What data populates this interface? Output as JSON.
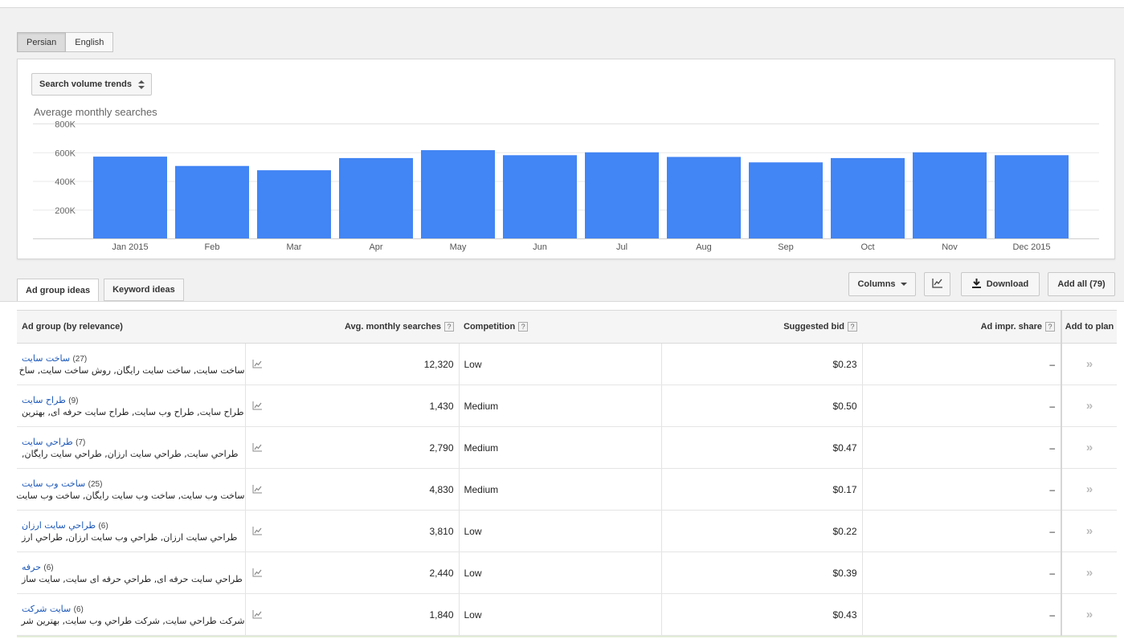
{
  "language_toggle": {
    "options": [
      "Persian",
      "English"
    ],
    "selected": "Persian"
  },
  "chart_panel": {
    "select_label": "Search volume trends"
  },
  "chart_data": {
    "type": "bar",
    "title": "Average monthly searches",
    "categories": [
      "Jan 2015",
      "Feb",
      "Mar",
      "Apr",
      "May",
      "Jun",
      "Jul",
      "Aug",
      "Sep",
      "Oct",
      "Nov",
      "Dec 2015"
    ],
    "values": [
      570000,
      505000,
      475000,
      560000,
      615000,
      580000,
      600000,
      568000,
      530000,
      560000,
      600000,
      580000
    ],
    "y_ticks": [
      "200K",
      "400K",
      "600K",
      "800K"
    ],
    "y_tick_values": [
      200000,
      400000,
      600000,
      800000
    ],
    "ylim": [
      0,
      800000
    ],
    "grid": true,
    "bar_color": "#4285f4"
  },
  "tabs": [
    {
      "label": "Ad group ideas",
      "active": true
    },
    {
      "label": "Keyword ideas",
      "active": false
    }
  ],
  "toolbar": {
    "columns_label": "Columns",
    "chart_icon": "line-chart-icon",
    "download_label": "Download",
    "add_all_label": "Add all (79)"
  },
  "table": {
    "headers": {
      "group": "Ad group (by relevance)",
      "searches": "Avg. monthly searches",
      "competition": "Competition",
      "bid": "Suggested bid",
      "share": "Ad impr. share",
      "add": "Add to plan"
    },
    "help_glyph": "?",
    "add_glyph": "»",
    "rows": [
      {
        "name": "ساخت سایت",
        "count": "(27)",
        "keywords": "ساخت سایت, ساخت سایت رایگان, روش ساخت سایت, ساخ",
        "searches": "12,320",
        "competition": "Low",
        "bid": "$0.23",
        "share": "–"
      },
      {
        "name": "طراح سایت",
        "count": "(9)",
        "keywords": "طراح سایت, طراح وب سایت, طراح سایت حرفه ای, بهترین",
        "searches": "1,430",
        "competition": "Medium",
        "bid": "$0.50",
        "share": "–"
      },
      {
        "name": "طراحي سایت",
        "count": "(7)",
        "keywords": "طراحي سایت, طراحي سایت ارزان, طراحي سایت رایگان,",
        "searches": "2,790",
        "competition": "Medium",
        "bid": "$0.47",
        "share": "–"
      },
      {
        "name": "ساخت وب سایت",
        "count": "(25)",
        "keywords": "ساخت وب سایت, ساخت وب سایت رایگان, ساخت وب سایت",
        "searches": "4,830",
        "competition": "Medium",
        "bid": "$0.17",
        "share": "–"
      },
      {
        "name": "طراحي سایت ارزان",
        "count": "(6)",
        "keywords": "طراحي سایت ارزان, طراحي وب سایت ارزان, طراحي ارز",
        "searches": "3,810",
        "competition": "Low",
        "bid": "$0.22",
        "share": "–"
      },
      {
        "name": "حرفه",
        "count": "(6)",
        "keywords": "طراحي سایت حرفه ای, طراحي حرفه ای سایت, سایت ساز",
        "searches": "2,440",
        "competition": "Low",
        "bid": "$0.39",
        "share": "–"
      },
      {
        "name": "سایت شرکت",
        "count": "(6)",
        "keywords": "شرکت طراحي سایت, شرکت طراحي وب سایت, بهترین شر",
        "searches": "1,840",
        "competition": "Low",
        "bid": "$0.43",
        "share": "–"
      }
    ]
  }
}
